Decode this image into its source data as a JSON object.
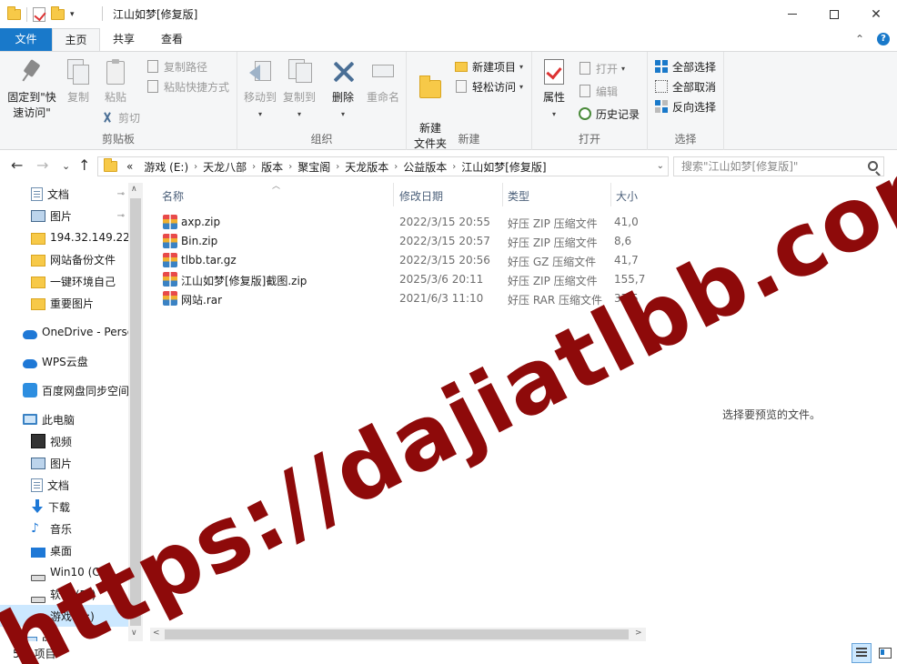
{
  "window": {
    "title": "江山如梦[修复版]",
    "qat_dropdown": "▾",
    "minimize": "—",
    "maximize": "☐",
    "close": "✕"
  },
  "tabs": {
    "file": "文件",
    "home": "主页",
    "share": "共享",
    "view": "查看",
    "collapse_ribbon": "⌃",
    "help": "?"
  },
  "ribbon": {
    "clipboard": {
      "label": "剪贴板",
      "pin_quick_access": "固定到\"快速访问\"",
      "copy": "复制",
      "paste": "粘贴",
      "copy_path": "复制路径",
      "paste_shortcut": "粘贴快捷方式",
      "cut": "剪切"
    },
    "organize": {
      "label": "组织",
      "move_to": "移动到",
      "copy_to": "复制到",
      "delete": "删除",
      "rename": "重命名"
    },
    "new": {
      "label": "新建",
      "new_folder": "新建\n文件夹",
      "new_item": "新建项目",
      "easy_access": "轻松访问"
    },
    "open": {
      "label": "打开",
      "properties": "属性",
      "open": "打开",
      "edit": "编辑",
      "history": "历史记录"
    },
    "select": {
      "label": "选择",
      "select_all": "全部选择",
      "select_none": "全部取消",
      "invert": "反向选择"
    }
  },
  "nav": {
    "back": "←",
    "forward": "→",
    "recent": "⌄",
    "up": "↑",
    "overflow": "«",
    "breadcrumb": [
      "游戏 (E:)",
      "天龙八部",
      "版本",
      "聚宝阁",
      "天龙版本",
      "公益版本",
      "江山如梦[修复版]"
    ],
    "search_placeholder": "搜索\"江山如梦[修复版]\""
  },
  "sidebar": {
    "quick_access": [
      {
        "label": "文档",
        "pinned": true
      },
      {
        "label": "图片",
        "pinned": true
      },
      {
        "label": "194.32.149.222",
        "pinned": false
      },
      {
        "label": "网站备份文件",
        "pinned": false
      },
      {
        "label": "一键环境自己",
        "pinned": false
      },
      {
        "label": "重要图片",
        "pinned": false
      }
    ],
    "onedrive": "OneDrive - Perso",
    "wps": "WPS云盘",
    "baidu": "百度网盘同步空间",
    "this_pc": "此电脑",
    "pc_items": [
      "视频",
      "图片",
      "文档",
      "下载",
      "音乐",
      "桌面",
      "Win10 (C:)",
      "软件 (D:)",
      "游戏 (E:)"
    ],
    "network": "网络",
    "pin_glyph": "📌"
  },
  "filelist": {
    "columns": {
      "name": "名称",
      "date": "修改日期",
      "type": "类型",
      "size": "大小"
    },
    "files": [
      {
        "name": "axp.zip",
        "date": "2022/3/15 20:55",
        "type": "好压 ZIP 压缩文件",
        "size": "41,0"
      },
      {
        "name": "Bin.zip",
        "date": "2022/3/15 20:57",
        "type": "好压 ZIP 压缩文件",
        "size": "8,6"
      },
      {
        "name": "tlbb.tar.gz",
        "date": "2022/3/15 20:56",
        "type": "好压 GZ 压缩文件",
        "size": "41,7"
      },
      {
        "name": "江山如梦[修复版]截图.zip",
        "date": "2025/3/6 20:11",
        "type": "好压 ZIP 压缩文件",
        "size": "155,7"
      },
      {
        "name": "网站.rar",
        "date": "2021/6/3 11:10",
        "type": "好压 RAR 压缩文件",
        "size": "37,5"
      }
    ]
  },
  "preview": {
    "empty_text": "选择要预览的文件。"
  },
  "status": {
    "item_count": "5 个项目"
  },
  "watermark": "https://dajiatlbb.com/"
}
